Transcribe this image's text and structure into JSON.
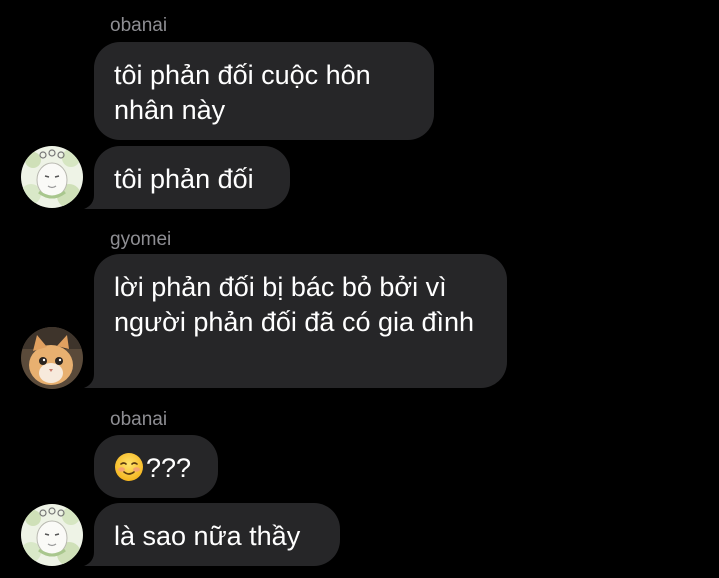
{
  "messages": [
    {
      "sender": "obanai",
      "text": "tôi phản đối cuộc hôn nhân này"
    },
    {
      "text": "tôi phản đối"
    },
    {
      "sender": "gyomei",
      "text": "lời phản đối bị bác bỏ bởi vì người phản đối đã có gia đình"
    },
    {
      "sender": "obanai",
      "emoji": "smiling-face-emoji",
      "text": "???"
    },
    {
      "text": "là sao nữa thầy"
    }
  ],
  "avatars": {
    "obanai": "snake-character-avatar",
    "gyomei": "cat-avatar"
  },
  "colors": {
    "background": "#000000",
    "bubble": "#262628",
    "sender_name": "#8e8e93",
    "text": "#ffffff"
  }
}
